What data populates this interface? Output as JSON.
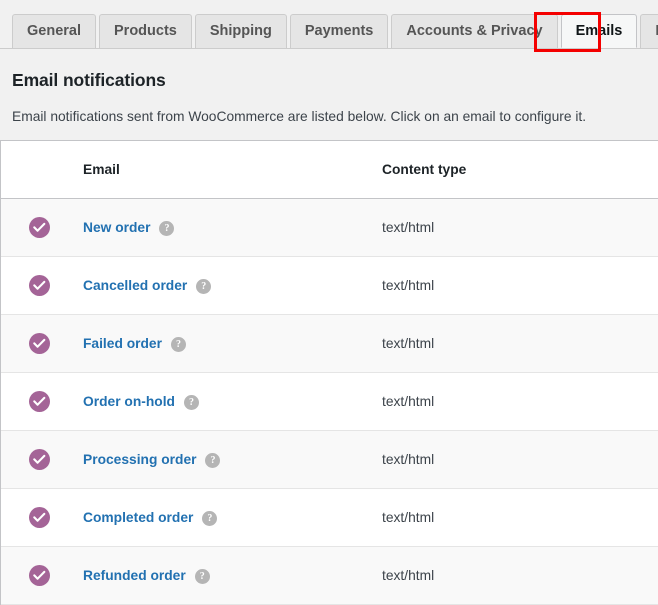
{
  "tabs": {
    "items": [
      {
        "label": "General",
        "active": false
      },
      {
        "label": "Products",
        "active": false
      },
      {
        "label": "Shipping",
        "active": false
      },
      {
        "label": "Payments",
        "active": false
      },
      {
        "label": "Accounts & Privacy",
        "active": false
      },
      {
        "label": "Emails",
        "active": true
      },
      {
        "label": "Integr",
        "active": false
      }
    ],
    "highlight_color": "#f40000",
    "highlighted_tab": "Emails"
  },
  "page": {
    "title": "Email notifications",
    "description": "Email notifications sent from WooCommerce are listed below. Click on an email to configure it."
  },
  "table": {
    "headers": {
      "status": "",
      "email": "Email",
      "content_type": "Content type"
    },
    "rows": [
      {
        "status_icon": "check-circle-icon",
        "status_color": "#a46497",
        "email": "New order",
        "help_icon": "?",
        "content_type": "text/html"
      },
      {
        "status_icon": "check-circle-icon",
        "status_color": "#a46497",
        "email": "Cancelled order",
        "help_icon": "?",
        "content_type": "text/html"
      },
      {
        "status_icon": "check-circle-icon",
        "status_color": "#a46497",
        "email": "Failed order",
        "help_icon": "?",
        "content_type": "text/html"
      },
      {
        "status_icon": "check-circle-icon",
        "status_color": "#a46497",
        "email": "Order on-hold",
        "help_icon": "?",
        "content_type": "text/html"
      },
      {
        "status_icon": "check-circle-icon",
        "status_color": "#a46497",
        "email": "Processing order",
        "help_icon": "?",
        "content_type": "text/html"
      },
      {
        "status_icon": "check-circle-icon",
        "status_color": "#a46497",
        "email": "Completed order",
        "help_icon": "?",
        "content_type": "text/html"
      },
      {
        "status_icon": "check-circle-icon",
        "status_color": "#a46497",
        "email": "Refunded order",
        "help_icon": "?",
        "content_type": "text/html"
      }
    ]
  },
  "colors": {
    "link": "#2271b1",
    "status_enabled": "#a46497",
    "page_bg": "#f1f1f1",
    "row_alt_bg": "#f9f9f9",
    "annotation": "#f40000"
  }
}
